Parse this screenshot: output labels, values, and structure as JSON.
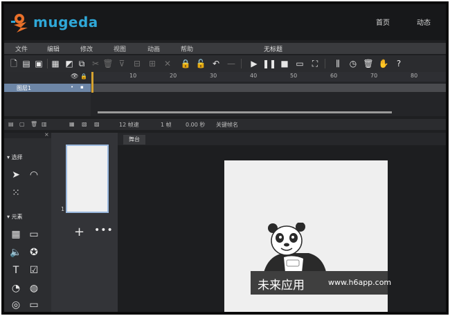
{
  "topnav": {
    "logo_text": "mugeda",
    "links": [
      "首页",
      "动态"
    ]
  },
  "menubar": {
    "items": [
      "文件",
      "编辑",
      "修改",
      "视图",
      "动画",
      "帮助"
    ],
    "doc_title": "无标题"
  },
  "timeline": {
    "ticks": [
      "10",
      "20",
      "30",
      "40",
      "50",
      "60",
      "70",
      "80"
    ],
    "layer_name": "图层1"
  },
  "timeline_status": {
    "fps": "12 帧速",
    "frame": "1 帧",
    "time": "0.00 秒",
    "keyframe": "关键帧名"
  },
  "tools": {
    "section_select": "选择",
    "section_element": "元素"
  },
  "frames": {
    "thumb_number": "1",
    "add_label": "+",
    "more_label": "•••"
  },
  "stage": {
    "tab_label": "舞台",
    "watermark_cn": "未来应用",
    "watermark_url": "www.h6app.com"
  },
  "colors": {
    "logo_blue": "#2fa8d8",
    "logo_orange": "#e8702a",
    "layer_row": "#6d86a6",
    "playhead": "#d6a330"
  }
}
